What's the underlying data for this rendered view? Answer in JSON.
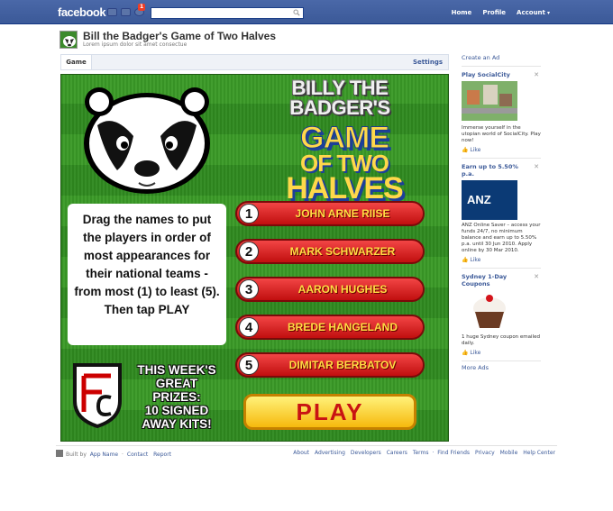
{
  "topbar": {
    "logo": "facebook",
    "notification_count": "1",
    "search_placeholder": "",
    "nav": [
      "Home",
      "Profile",
      "Account"
    ]
  },
  "app": {
    "title": "Bill the Badger's Game of Two Halves",
    "subtitle": "Lorem ipsum dolor sit amet consectue",
    "tab": "Game",
    "settings": "Settings"
  },
  "game": {
    "brand_line1": "BILLY THE",
    "brand_line2": "BADGER'S",
    "brand_game": "GAME",
    "brand_of_two": "OF TWO",
    "brand_halves": "HALVES",
    "instructions": "Drag the names to put the players in order of most appearances for their national teams - from most (1) to least (5). Then tap PLAY",
    "players": [
      {
        "num": "1",
        "name": "JOHN ARNE RIISE"
      },
      {
        "num": "2",
        "name": "MARK SCHWARZER"
      },
      {
        "num": "3",
        "name": "AARON HUGHES"
      },
      {
        "num": "4",
        "name": "BREDE HANGELAND"
      },
      {
        "num": "5",
        "name": "DIMITAR BERBATOV"
      }
    ],
    "prize_l1": "THIS WEEK'S",
    "prize_l2": "GREAT",
    "prize_l3": "PRIZES:",
    "prize_l4": "10 SIGNED",
    "prize_l5": "AWAY KITS!",
    "crest_letters": "FFC",
    "play_label": "PLAY"
  },
  "sidebar": {
    "create_ad": "Create an Ad",
    "ads": [
      {
        "title": "Play SocialCity",
        "text": "Immerse yourself in the utopian world of SocialCity. Play now!",
        "like": "Like"
      },
      {
        "title": "Earn up to 5.50% p.a.",
        "text": "ANZ Online Saver – access your funds 24/7, no minimum balance and earn up to 5.50% p.a. until 30 Jun 2010. Apply online by 30 Mar 2010.",
        "like": "Like",
        "logo": "ANZ"
      },
      {
        "title": "Sydney 1-Day Coupons",
        "text": "1 huge Sydney coupon emailed daily.",
        "like": "Like"
      }
    ],
    "more_ads": "More Ads"
  },
  "footer": {
    "built_by": "Built by",
    "left_links": [
      "App Name",
      "Contact",
      "Report"
    ],
    "right_links": [
      "About",
      "Advertising",
      "Developers",
      "Careers",
      "Terms",
      "Find Friends",
      "Privacy",
      "Mobile",
      "Help Center"
    ]
  },
  "colors": {
    "fb_blue": "#3b5998",
    "pitch_green": "#2f8a1f",
    "pill_red": "#d21c1c",
    "play_yellow": "#f6c01d"
  }
}
